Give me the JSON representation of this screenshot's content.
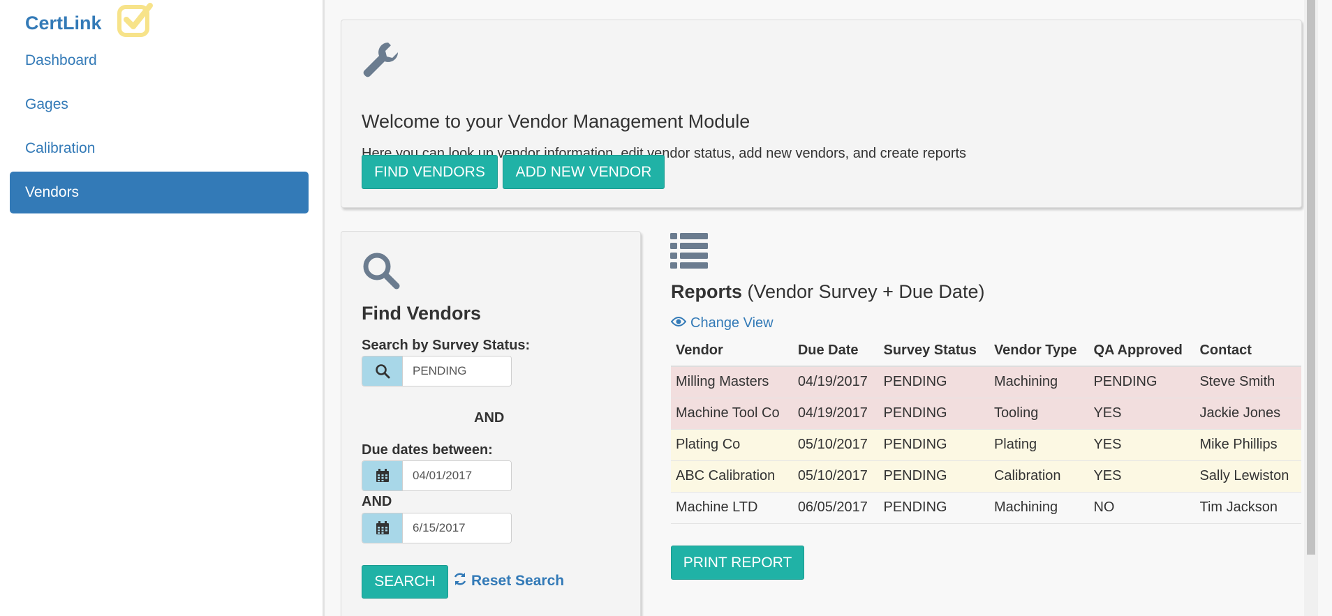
{
  "sidebar": {
    "brand": "CertLink",
    "items": [
      {
        "label": "Dashboard"
      },
      {
        "label": "Gages"
      },
      {
        "label": "Calibration"
      },
      {
        "label": "Vendors",
        "active": true
      }
    ]
  },
  "welcome": {
    "title": "Welcome to your Vendor Management Module",
    "description": "Here you can look up vendor information, edit vendor status, add new vendors, and create reports",
    "find_vendors_label": "FIND VENDORS",
    "add_vendor_label": "ADD NEW VENDOR"
  },
  "find": {
    "title": "Find Vendors",
    "status_label": "Search by Survey Status:",
    "status_value": "PENDING",
    "and_label_1": "AND",
    "due_label": "Due dates between:",
    "date_from": "04/01/2017",
    "and_label_2": "AND",
    "date_to": "6/15/2017",
    "search_label": "SEARCH",
    "reset_label": "Reset Search"
  },
  "reports": {
    "title_bold": "Reports",
    "title_rest": "(Vendor Survey + Due Date)",
    "change_view_label": "Change View",
    "columns": [
      "Vendor",
      "Due Date",
      "Survey Status",
      "Vendor Type",
      "QA Approved",
      "Contact"
    ],
    "rows": [
      {
        "status": "danger",
        "cells": [
          "Milling Masters",
          "04/19/2017",
          "PENDING",
          "Machining",
          "PENDING",
          "Steve Smith"
        ]
      },
      {
        "status": "danger",
        "cells": [
          "Machine Tool Co",
          "04/19/2017",
          "PENDING",
          "Tooling",
          "YES",
          "Jackie Jones"
        ]
      },
      {
        "status": "warning",
        "cells": [
          "Plating Co",
          "05/10/2017",
          "PENDING",
          "Plating",
          "YES",
          "Mike Phillips"
        ]
      },
      {
        "status": "warning",
        "cells": [
          "ABC Calibration",
          "05/10/2017",
          "PENDING",
          "Calibration",
          "YES",
          "Sally Lewiston"
        ]
      },
      {
        "status": "none",
        "cells": [
          "Machine LTD",
          "06/05/2017",
          "PENDING",
          "Machining",
          "NO",
          "Tim Jackson"
        ]
      }
    ],
    "print_label": "PRINT REPORT"
  },
  "colors": {
    "primary": "#337ab7",
    "accent": "#20b2a6",
    "danger_row": "#f2dede",
    "warning_row": "#fcf8e3",
    "logo": "#f7e38a",
    "icon_gray": "#6b7c8f"
  },
  "icons": {
    "brand": "checkbox-icon",
    "welcome": "wrench-icon",
    "find": "magnifier-icon",
    "reports": "list-icon",
    "change_view": "eye-icon",
    "reset": "refresh-icon",
    "status_addon": "search-icon",
    "date_addon": "calendar-icon"
  }
}
